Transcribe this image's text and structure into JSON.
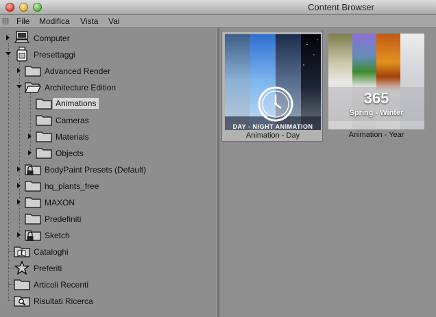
{
  "window": {
    "title": "Content Browser"
  },
  "menu": [
    "File",
    "Modifica",
    "Vista",
    "Vai"
  ],
  "tree": {
    "computer": "Computer",
    "presettaggi": "Presettaggi",
    "advanced_render": "Advanced Render",
    "architecture_edition": "Architecture Edition",
    "animations": "Animations",
    "cameras": "Cameras",
    "materials": "Materials",
    "objects": "Objects",
    "bodypaint": "BodyPaint Presets (Default)",
    "hq_plants": "hq_plants_free",
    "maxon": "MAXON",
    "predefiniti": "Predefiniti",
    "sketch": "Sketch",
    "cataloghi": "Cataloghi",
    "preferiti": "Preferiti",
    "articoli_recenti": "Articoli Recenti",
    "risultati_ricerca": "Risultati Ricerca"
  },
  "thumbnails": [
    {
      "caption": "Animation - Day",
      "overlay": "DAY - NIGHT ANIMATION",
      "selected": true
    },
    {
      "caption": "Animation - Year",
      "number": "365",
      "subtitle": "Spring - Winter",
      "selected": false
    }
  ]
}
